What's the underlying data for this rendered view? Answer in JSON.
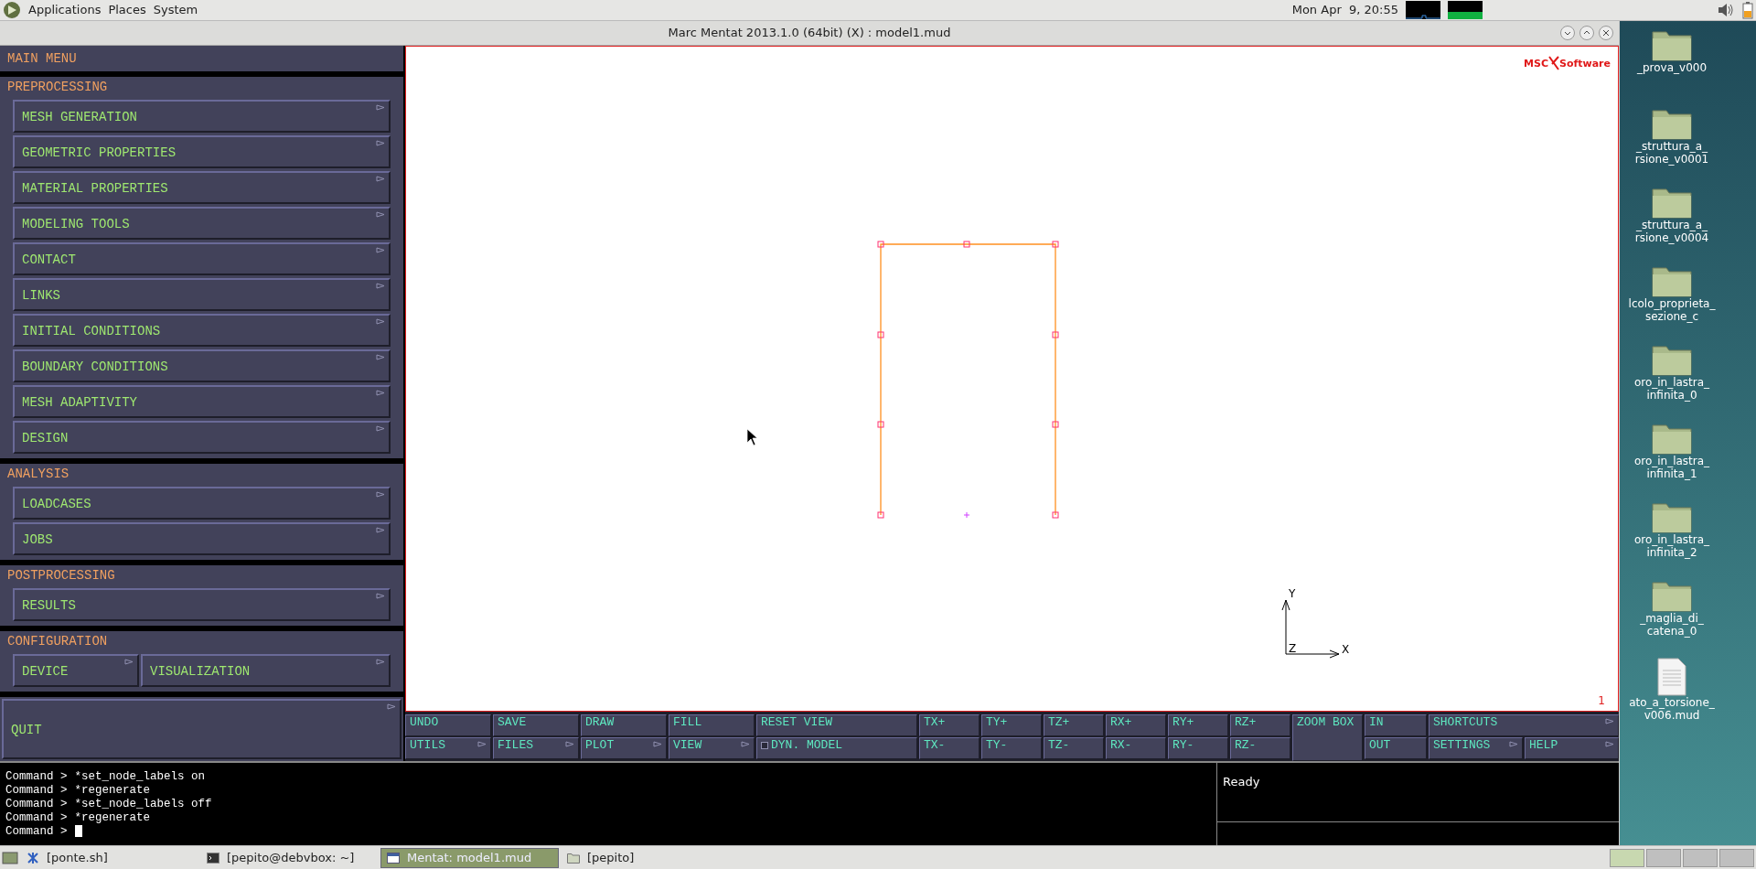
{
  "top_panel": {
    "menus": [
      "Applications",
      "Places",
      "System"
    ],
    "clock": "Mon Apr  9, 20:55"
  },
  "window": {
    "title": "Marc Mentat 2013.1.0 (64bit) (X) : model1.mud"
  },
  "main_menu": {
    "title": "MAIN MENU",
    "sections": [
      {
        "heading": "PREPROCESSING",
        "rows": [
          [
            {
              "label": "MESH GENERATION",
              "submenu": true
            }
          ],
          [
            {
              "label": "GEOMETRIC PROPERTIES",
              "submenu": true
            }
          ],
          [
            {
              "label": "MATERIAL PROPERTIES",
              "submenu": true
            }
          ],
          [
            {
              "label": "MODELING TOOLS",
              "submenu": true
            }
          ],
          [
            {
              "label": "CONTACT",
              "submenu": true
            }
          ],
          [
            {
              "label": "LINKS",
              "submenu": true
            }
          ],
          [
            {
              "label": "INITIAL CONDITIONS",
              "submenu": true
            }
          ],
          [
            {
              "label": "BOUNDARY CONDITIONS",
              "submenu": true
            }
          ],
          [
            {
              "label": "MESH ADAPTIVITY",
              "submenu": true
            }
          ],
          [
            {
              "label": "DESIGN",
              "submenu": true
            }
          ]
        ]
      },
      {
        "heading": "ANALYSIS",
        "rows": [
          [
            {
              "label": "LOADCASES",
              "submenu": true
            }
          ],
          [
            {
              "label": "JOBS",
              "submenu": true
            }
          ]
        ]
      },
      {
        "heading": "POSTPROCESSING",
        "rows": [
          [
            {
              "label": "RESULTS",
              "submenu": true
            }
          ]
        ]
      },
      {
        "heading": "CONFIGURATION",
        "rows": [
          [
            {
              "label": "DEVICE",
              "submenu": true
            },
            {
              "label": "VISUALIZATION",
              "submenu": true
            }
          ]
        ]
      }
    ],
    "quit": {
      "label": "QUIT",
      "submenu": true
    }
  },
  "viewport": {
    "logo": {
      "brand": "MSC",
      "word": "Software"
    },
    "axes": {
      "x": "X",
      "y": "Y",
      "z": "Z"
    },
    "viewport_number": "1"
  },
  "toolbar": [
    {
      "rows": [
        [
          {
            "label": "UNDO",
            "kind": "button",
            "submenu": false
          }
        ],
        [
          {
            "label": "UTILS",
            "kind": "button",
            "submenu": true
          }
        ]
      ]
    },
    {
      "rows": [
        [
          {
            "label": "SAVE",
            "kind": "button",
            "submenu": false
          }
        ],
        [
          {
            "label": "FILES",
            "kind": "button",
            "submenu": true
          }
        ]
      ]
    },
    {
      "rows": [
        [
          {
            "label": "DRAW",
            "kind": "button",
            "submenu": false
          }
        ],
        [
          {
            "label": "PLOT",
            "kind": "button",
            "submenu": true
          }
        ]
      ]
    },
    {
      "rows": [
        [
          {
            "label": "FILL",
            "kind": "button",
            "submenu": false
          }
        ],
        [
          {
            "label": "VIEW",
            "kind": "button",
            "submenu": true
          }
        ]
      ]
    },
    {
      "rows": [
        [
          {
            "label": "RESET VIEW",
            "kind": "button",
            "submenu": false
          }
        ],
        [
          {
            "label": "DYN. MODEL",
            "kind": "toggle",
            "checked": false,
            "submenu": false
          }
        ]
      ]
    },
    {
      "rows": [
        [
          {
            "label": "TX+",
            "kind": "button",
            "submenu": false
          }
        ],
        [
          {
            "label": "TX-",
            "kind": "button",
            "submenu": false
          }
        ]
      ]
    },
    {
      "rows": [
        [
          {
            "label": "TY+",
            "kind": "button",
            "submenu": false
          }
        ],
        [
          {
            "label": "TY-",
            "kind": "button",
            "submenu": false
          }
        ]
      ]
    },
    {
      "rows": [
        [
          {
            "label": "TZ+",
            "kind": "button",
            "submenu": false
          }
        ],
        [
          {
            "label": "TZ-",
            "kind": "button",
            "submenu": false
          }
        ]
      ]
    },
    {
      "rows": [
        [
          {
            "label": "RX+",
            "kind": "button",
            "submenu": false
          }
        ],
        [
          {
            "label": "RX-",
            "kind": "button",
            "submenu": false
          }
        ]
      ]
    },
    {
      "rows": [
        [
          {
            "label": "RY+",
            "kind": "button",
            "submenu": false
          }
        ],
        [
          {
            "label": "RY-",
            "kind": "button",
            "submenu": false
          }
        ]
      ]
    },
    {
      "rows": [
        [
          {
            "label": "RZ+",
            "kind": "button",
            "submenu": false
          }
        ],
        [
          {
            "label": "RZ-",
            "kind": "button",
            "submenu": false
          }
        ]
      ]
    },
    {
      "rows": [
        [
          {
            "label": "ZOOM BOX",
            "kind": "button",
            "submenu": false
          }
        ]
      ]
    },
    {
      "rows": [
        [
          {
            "label": "IN",
            "kind": "button",
            "submenu": false
          }
        ],
        [
          {
            "label": "OUT",
            "kind": "button",
            "submenu": false
          }
        ]
      ]
    },
    {
      "rows": [
        [
          {
            "label": "SHORTCUTS",
            "kind": "button",
            "submenu": true
          }
        ],
        [
          {
            "label": "SETTINGS",
            "kind": "button",
            "submenu": true
          },
          {
            "label": "HELP",
            "kind": "button",
            "submenu": true
          }
        ]
      ]
    }
  ],
  "command_log": [
    {
      "prompt": "Command >",
      "text": "*set_node_labels on"
    },
    {
      "prompt": "Command >",
      "text": "*regenerate"
    },
    {
      "prompt": "Command >",
      "text": "*set_node_labels off"
    },
    {
      "prompt": "Command >",
      "text": "*regenerate"
    },
    {
      "prompt": "Command >"
    }
  ],
  "status": "Ready",
  "desktop_icons": [
    {
      "kind": "folder",
      "lines": [
        "_prova_v000"
      ]
    },
    {
      "kind": "folder",
      "lines": [
        "_struttura_a_",
        "rsione_v0001"
      ]
    },
    {
      "kind": "folder",
      "lines": [
        "_struttura_a_",
        "rsione_v0004"
      ]
    },
    {
      "kind": "folder",
      "lines": [
        "lcolo_proprieta_",
        "sezione_c"
      ]
    },
    {
      "kind": "folder",
      "lines": [
        "oro_in_lastra_",
        "infinita_0"
      ]
    },
    {
      "kind": "folder",
      "lines": [
        "oro_in_lastra_",
        "infinita_1"
      ]
    },
    {
      "kind": "folder",
      "lines": [
        "oro_in_lastra_",
        "infinita_2"
      ]
    },
    {
      "kind": "folder",
      "lines": [
        "_maglia_di_",
        "catena_0"
      ]
    },
    {
      "kind": "file",
      "lines": [
        "ato_a_torsione_",
        "v006.mud"
      ]
    }
  ],
  "taskbar": {
    "items": [
      {
        "label": "[ponte.sh]",
        "kind": "script",
        "selected": false
      },
      {
        "label": "[pepito@debvbox: ~]",
        "kind": "terminal",
        "selected": false
      },
      {
        "label": "Mentat: model1.mud",
        "kind": "window",
        "selected": true
      },
      {
        "label": "[pepito]",
        "kind": "folder",
        "selected": false
      }
    ],
    "workspaces": [
      {
        "selected": true
      },
      {
        "selected": false
      },
      {
        "selected": false
      },
      {
        "selected": false
      }
    ]
  }
}
